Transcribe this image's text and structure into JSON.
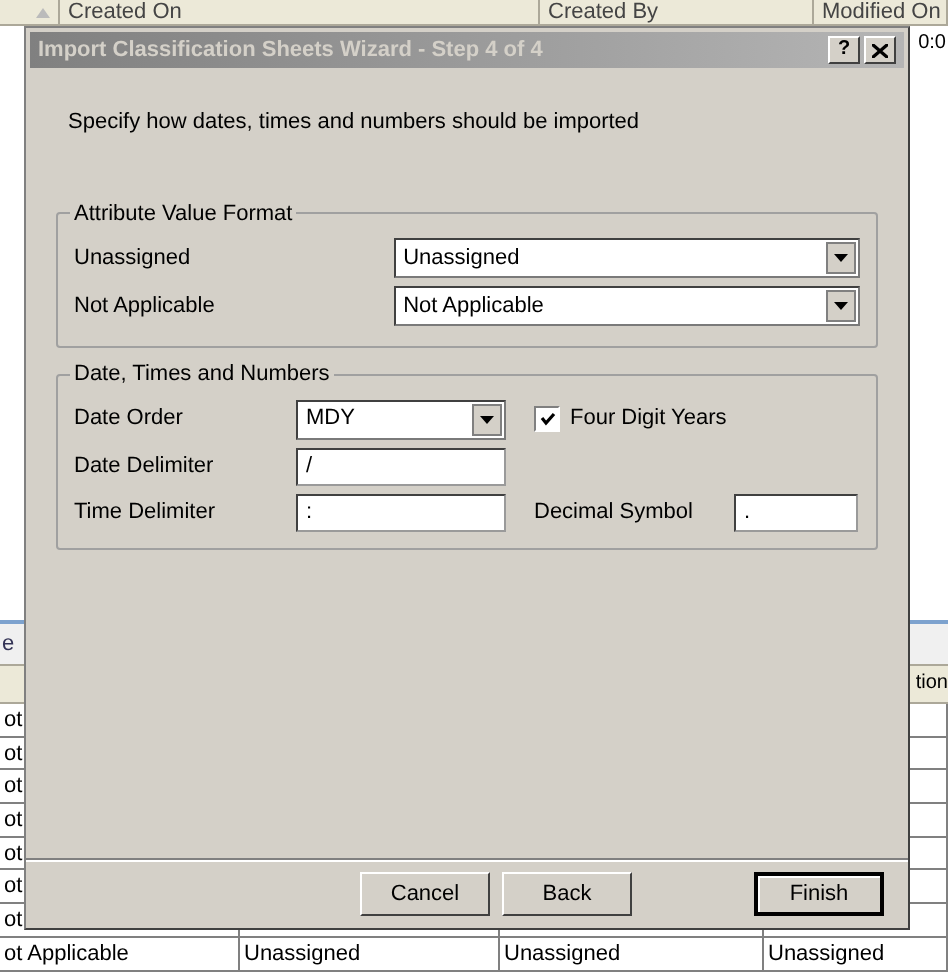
{
  "background_top": {
    "columns": [
      "Created On",
      "Created By",
      "Modified On"
    ],
    "row_cell": "0:0"
  },
  "background_bottom": {
    "section_label": "e",
    "column_label": "tion",
    "rows": [
      {
        "cells": [
          "ot"
        ]
      },
      {
        "cells": [
          "ot"
        ]
      },
      {
        "cells": [
          "ot"
        ]
      },
      {
        "cells": [
          "ot"
        ]
      },
      {
        "cells": [
          "ot"
        ]
      },
      {
        "cells": [
          "ot"
        ]
      },
      {
        "cells": [
          "ot"
        ]
      },
      {
        "cells": [
          "ot Applicable",
          "Unassigned",
          "Unassigned",
          "Unassigned"
        ]
      }
    ]
  },
  "dialog": {
    "title": "Import Classification Sheets Wizard - Step 4 of 4",
    "help": "?",
    "instruction": "Specify how dates, times and  numbers should be imported",
    "attribute_group": {
      "title": "Attribute Value Format",
      "rows": [
        {
          "label": "Unassigned",
          "value": "Unassigned"
        },
        {
          "label": "Not Applicable",
          "value": "Not Applicable"
        }
      ]
    },
    "date_group": {
      "title": "Date, Times and Numbers",
      "date_order": {
        "label": "Date Order",
        "value": "MDY"
      },
      "four_digit_years": {
        "label": "Four Digit Years",
        "checked": true
      },
      "date_delimiter": {
        "label": "Date Delimiter",
        "value": "/"
      },
      "time_delimiter": {
        "label": "Time Delimiter",
        "value": ":"
      },
      "decimal_symbol": {
        "label": "Decimal Symbol",
        "value": "."
      }
    },
    "buttons": [
      {
        "label": "Cancel",
        "default": false
      },
      {
        "label": "Back",
        "default": false
      },
      {
        "label": "Finish",
        "default": true
      }
    ]
  }
}
